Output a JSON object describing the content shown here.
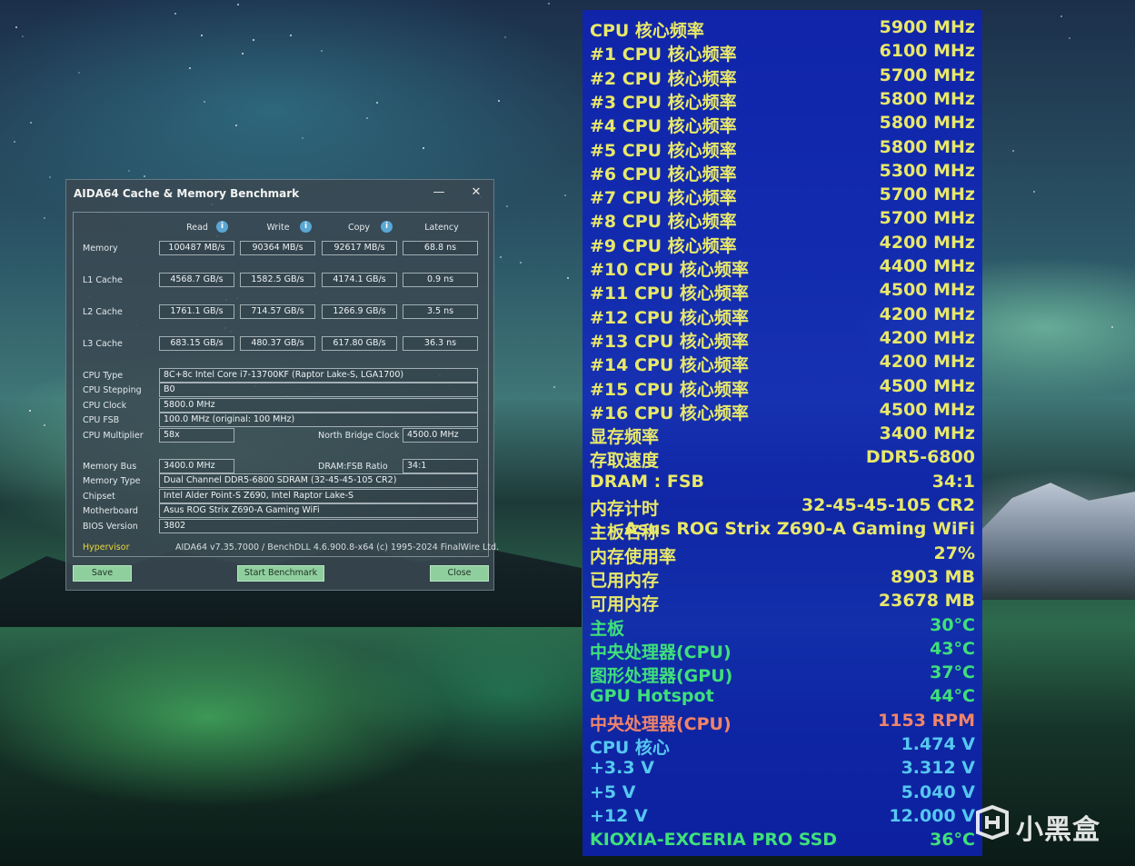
{
  "aida": {
    "title": "AIDA64 Cache & Memory Benchmark",
    "minimize_glyph": "—",
    "close_glyph": "✕",
    "columns": {
      "read": "Read",
      "write": "Write",
      "copy": "Copy",
      "latency": "Latency"
    },
    "info_glyph": "i",
    "rows": [
      {
        "label": "Memory",
        "read": "100487 MB/s",
        "write": "90364 MB/s",
        "copy": "92617 MB/s",
        "latency": "68.8 ns"
      },
      {
        "label": "L1 Cache",
        "read": "4568.7 GB/s",
        "write": "1582.5 GB/s",
        "copy": "4174.1 GB/s",
        "latency": "0.9 ns"
      },
      {
        "label": "L2 Cache",
        "read": "1761.1 GB/s",
        "write": "714.57 GB/s",
        "copy": "1266.9 GB/s",
        "latency": "3.5 ns"
      },
      {
        "label": "L3 Cache",
        "read": "683.15 GB/s",
        "write": "480.37 GB/s",
        "copy": "617.80 GB/s",
        "latency": "36.3 ns"
      }
    ],
    "cpu_type_label": "CPU Type",
    "cpu_type": "8C+8c Intel Core i7-13700KF  (Raptor Lake-S, LGA1700)",
    "cpu_stepping_label": "CPU Stepping",
    "cpu_stepping": "B0",
    "cpu_clock_label": "CPU Clock",
    "cpu_clock": "5800.0 MHz",
    "cpu_fsb_label": "CPU FSB",
    "cpu_fsb": "100.0 MHz  (original: 100 MHz)",
    "cpu_multiplier_label": "CPU Multiplier",
    "cpu_multiplier": "58x",
    "nb_clock_label": "North Bridge Clock",
    "nb_clock": "4500.0 MHz",
    "memory_bus_label": "Memory Bus",
    "memory_bus": "3400.0 MHz",
    "dram_fsb_label": "DRAM:FSB Ratio",
    "dram_fsb": "34:1",
    "memory_type_label": "Memory Type",
    "memory_type": "Dual Channel DDR5-6800 SDRAM  (32-45-45-105 CR2)",
    "chipset_label": "Chipset",
    "chipset": "Intel Alder Point-S Z690, Intel Raptor Lake-S",
    "motherboard_label": "Motherboard",
    "motherboard": "Asus ROG Strix Z690-A Gaming WiFi",
    "bios_label": "BIOS Version",
    "bios": "3802",
    "hypervisor": "Hypervisor",
    "copyright": "AIDA64 v7.35.7000 / BenchDLL 4.6.900.8-x64  (c) 1995-2024 FinalWire Ltd.",
    "save_label": "Save",
    "start_label": "Start Benchmark",
    "close_label": "Close",
    "button_color": "#8fcf9e",
    "hypervisor_color": "#e9d53c"
  },
  "osd": {
    "colors": {
      "background": "#0e22be",
      "yellow": "#e8e86a",
      "green": "#3fe07a",
      "orange": "#f0846a",
      "cyan": "#56c8f0"
    },
    "rows": [
      {
        "key": "CPU 核心频率",
        "value": "5900 MHz",
        "color": "#e8e86a"
      },
      {
        "key": "#1 CPU 核心频率",
        "value": "6100 MHz",
        "color": "#e8e86a"
      },
      {
        "key": "#2 CPU 核心频率",
        "value": "5700 MHz",
        "color": "#e8e86a"
      },
      {
        "key": "#3 CPU 核心频率",
        "value": "5800 MHz",
        "color": "#e8e86a"
      },
      {
        "key": "#4 CPU 核心频率",
        "value": "5800 MHz",
        "color": "#e8e86a"
      },
      {
        "key": "#5 CPU 核心频率",
        "value": "5800 MHz",
        "color": "#e8e86a"
      },
      {
        "key": "#6 CPU 核心频率",
        "value": "5300 MHz",
        "color": "#e8e86a"
      },
      {
        "key": "#7 CPU 核心频率",
        "value": "5700 MHz",
        "color": "#e8e86a"
      },
      {
        "key": "#8 CPU 核心频率",
        "value": "5700 MHz",
        "color": "#e8e86a"
      },
      {
        "key": "#9 CPU 核心频率",
        "value": "4200 MHz",
        "color": "#e8e86a"
      },
      {
        "key": "#10 CPU 核心频率",
        "value": "4400 MHz",
        "color": "#e8e86a"
      },
      {
        "key": "#11 CPU 核心频率",
        "value": "4500 MHz",
        "color": "#e8e86a"
      },
      {
        "key": "#12 CPU 核心频率",
        "value": "4200 MHz",
        "color": "#e8e86a"
      },
      {
        "key": "#13 CPU 核心频率",
        "value": "4200 MHz",
        "color": "#e8e86a"
      },
      {
        "key": "#14 CPU 核心频率",
        "value": "4200 MHz",
        "color": "#e8e86a"
      },
      {
        "key": "#15 CPU 核心频率",
        "value": "4500 MHz",
        "color": "#e8e86a"
      },
      {
        "key": "#16 CPU 核心频率",
        "value": "4500 MHz",
        "color": "#e8e86a"
      },
      {
        "key": "显存频率",
        "value": "3400 MHz",
        "color": "#e8e86a"
      },
      {
        "key": "存取速度",
        "value": "DDR5-6800",
        "color": "#e8e86a"
      },
      {
        "key": "DRAM : FSB",
        "value": "34:1",
        "color": "#e8e86a"
      },
      {
        "key": "内存计时",
        "value": "32-45-45-105 CR2",
        "color": "#e8e86a"
      },
      {
        "key": "主板名称",
        "value": "Asus ROG Strix Z690-A Gaming WiFi",
        "color": "#e8e86a"
      },
      {
        "key": "内存使用率",
        "value": "27%",
        "color": "#e8e86a"
      },
      {
        "key": "已用内存",
        "value": "8903 MB",
        "color": "#e8e86a"
      },
      {
        "key": "可用内存",
        "value": "23678 MB",
        "color": "#e8e86a"
      },
      {
        "key": "主板",
        "value": "30°C",
        "color": "#3fe07a"
      },
      {
        "key": "中央处理器(CPU)",
        "value": "43°C",
        "color": "#3fe07a"
      },
      {
        "key": "图形处理器(GPU)",
        "value": "37°C",
        "color": "#3fe07a"
      },
      {
        "key": "GPU Hotspot",
        "value": "44°C",
        "color": "#3fe07a"
      },
      {
        "key": "中央处理器(CPU)",
        "value": "1153 RPM",
        "color": "#f0846a"
      },
      {
        "key": "CPU 核心",
        "value": "1.474 V",
        "color": "#56c8f0"
      },
      {
        "key": "+3.3 V",
        "value": "3.312 V",
        "color": "#56c8f0"
      },
      {
        "key": "+5 V",
        "value": "5.040 V",
        "color": "#56c8f0"
      },
      {
        "key": "+12 V",
        "value": "12.000 V",
        "color": "#56c8f0"
      },
      {
        "key": "KIOXIA-EXCERIA PRO SSD",
        "value": "36°C",
        "color": "#3fe07a"
      }
    ]
  },
  "watermark": {
    "text": "小黑盒"
  }
}
